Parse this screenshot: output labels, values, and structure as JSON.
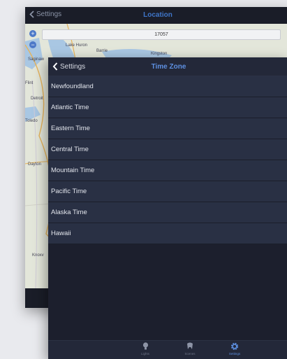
{
  "location_panel": {
    "back_label": "Settings",
    "title": "Location",
    "search_value": "17057",
    "map_labels": [
      "Lake Huron",
      "Barrie",
      "Kingston",
      "Saginaw",
      "Flint",
      "Detroit",
      "Toledo",
      "Dayton",
      "Knoxv"
    ]
  },
  "timezone_panel": {
    "back_label": "Settings",
    "title": "Time Zone",
    "items": [
      {
        "label": "Newfoundland"
      },
      {
        "label": "Atlantic Time"
      },
      {
        "label": "Eastern Time"
      },
      {
        "label": "Central Time"
      },
      {
        "label": "Mountain Time"
      },
      {
        "label": "Pacific Time"
      },
      {
        "label": "Alaska Time"
      },
      {
        "label": "Hawaii"
      }
    ]
  },
  "tabbar": {
    "tabs": [
      {
        "label": "Lights",
        "icon": "lightbulb-icon"
      },
      {
        "label": "Scenes",
        "icon": "scenes-icon"
      },
      {
        "label": "Settings",
        "icon": "gear-icon",
        "active": true
      }
    ]
  },
  "colors": {
    "accent": "#5d8fe0",
    "row_bg": "#293044",
    "panel_bg": "#1c1f2d"
  }
}
